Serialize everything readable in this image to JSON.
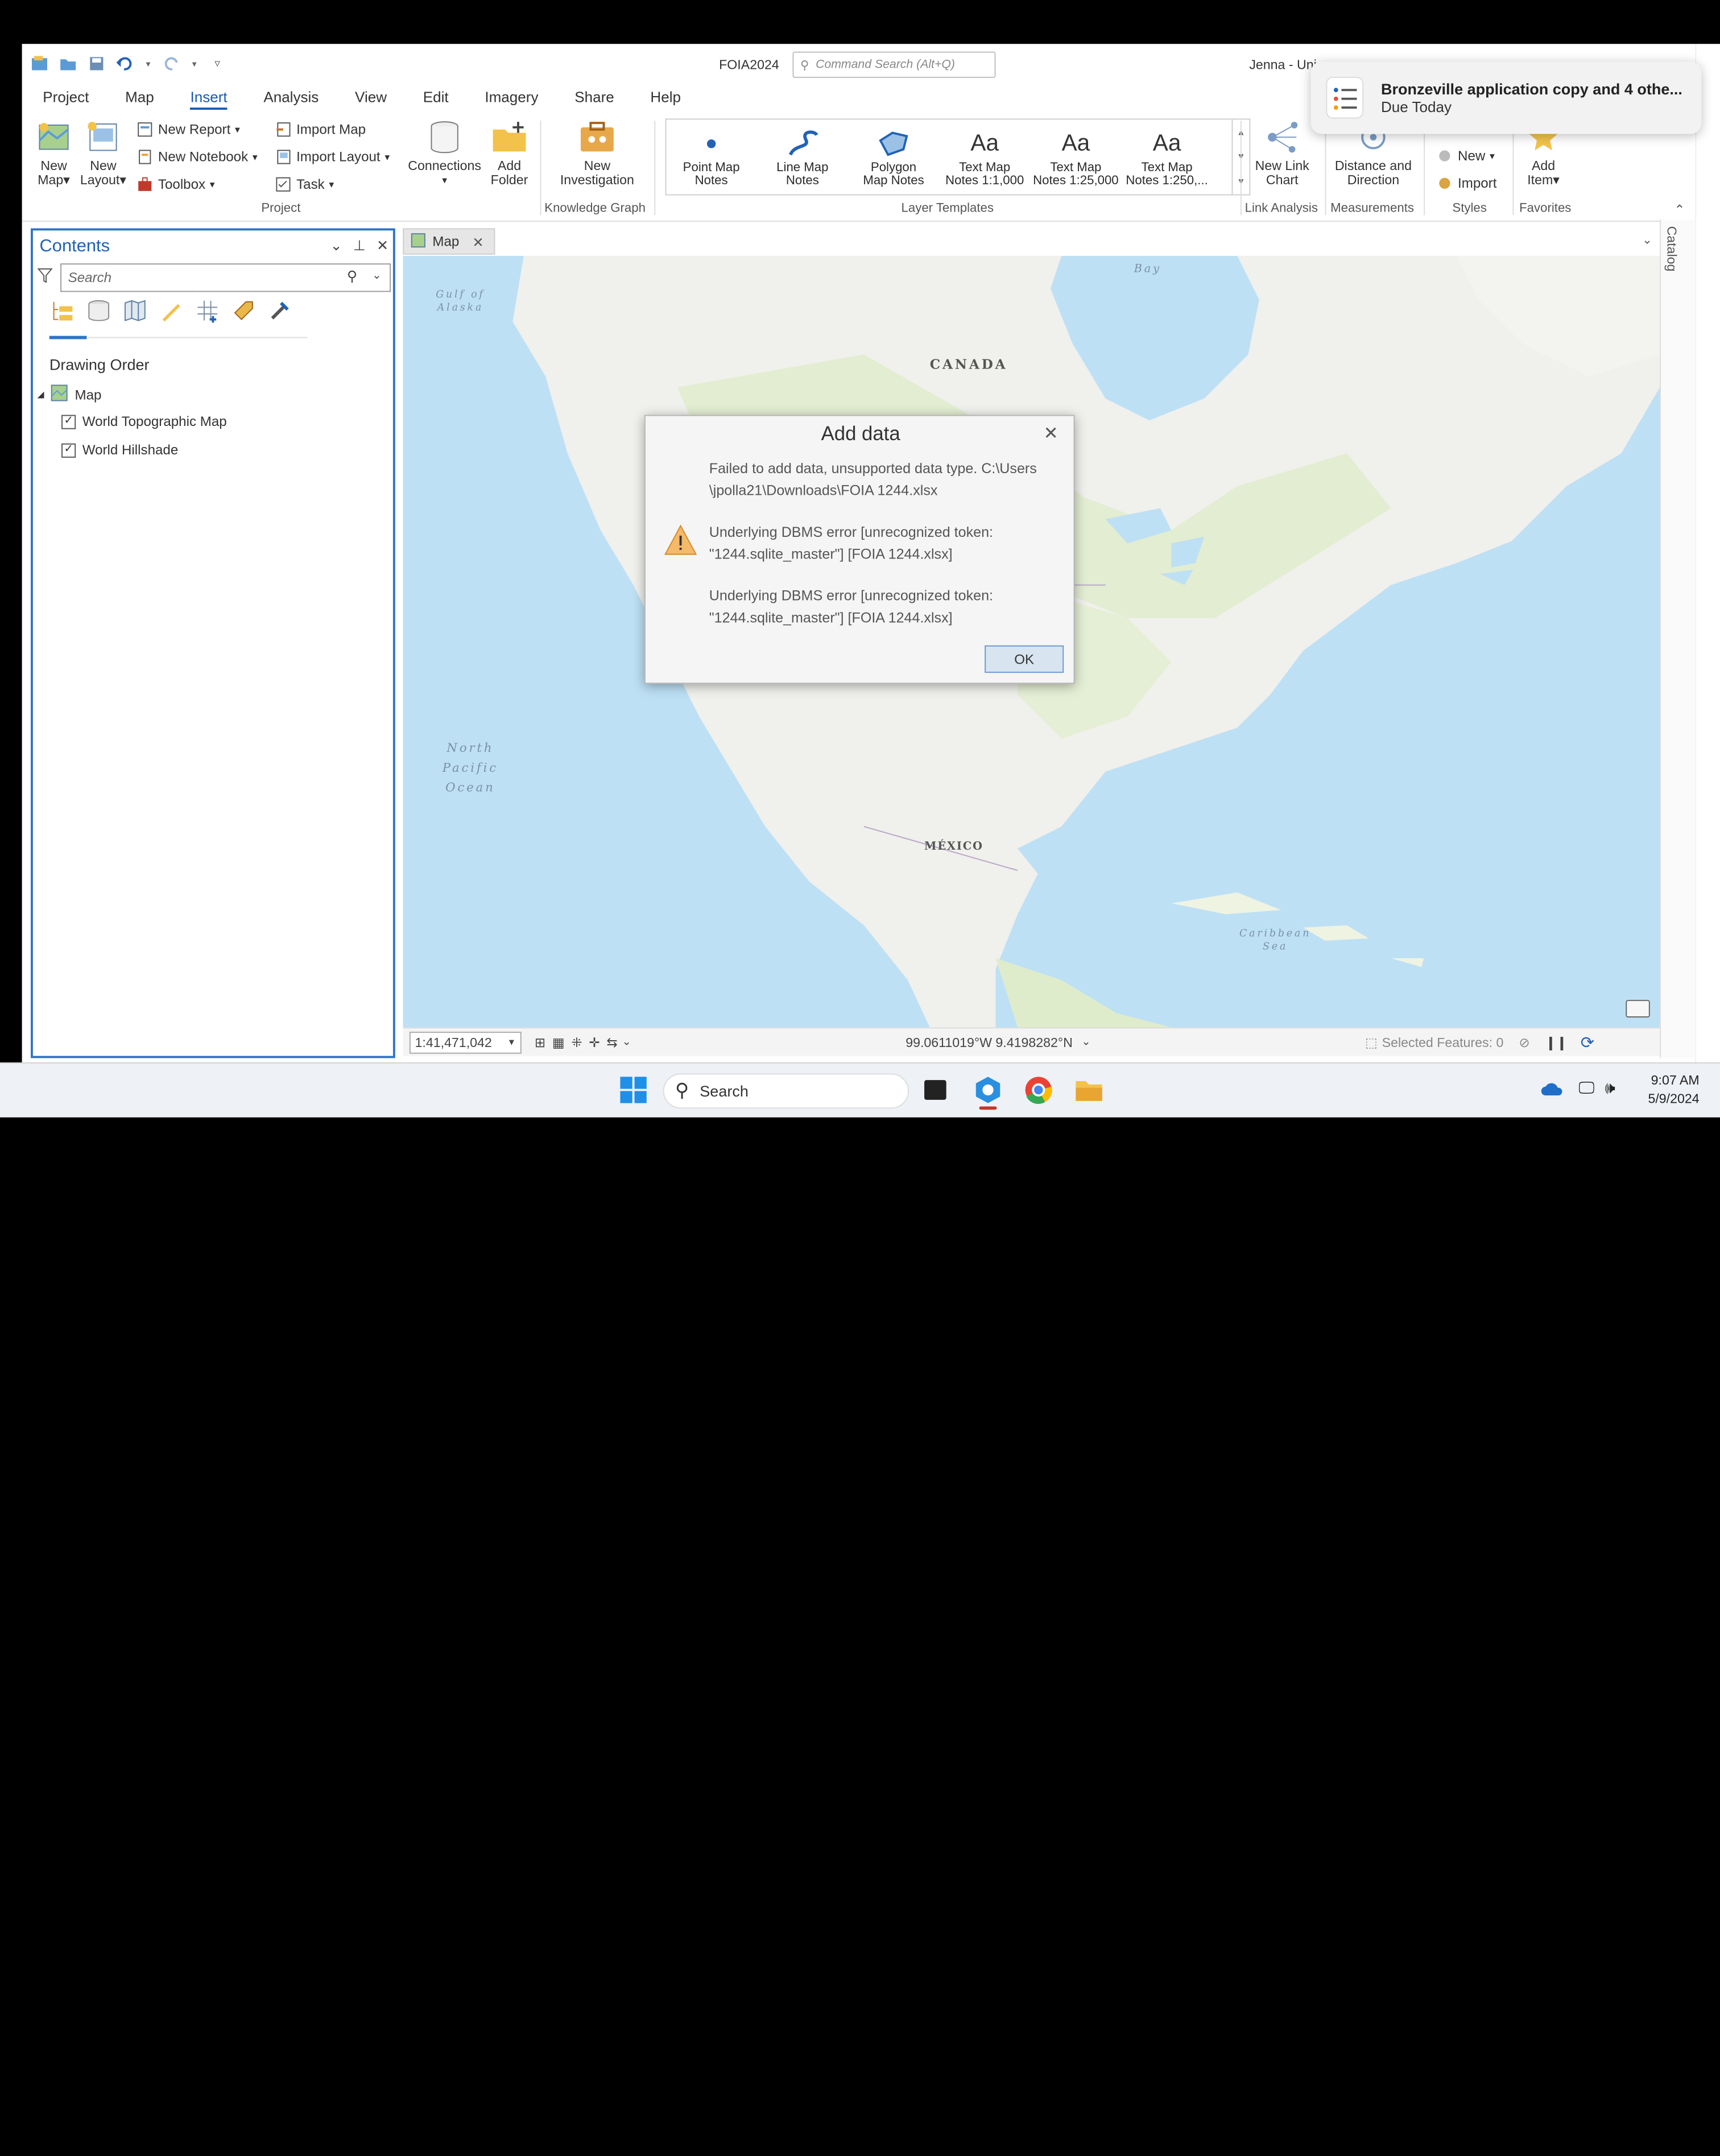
{
  "app": {
    "doc_title": "FOIA2024",
    "command_search_placeholder": "Command Search (Alt+Q)",
    "user_name": "Jenna - Uni"
  },
  "tabs": [
    {
      "label": "Project"
    },
    {
      "label": "Map"
    },
    {
      "label": "Insert"
    },
    {
      "label": "Analysis"
    },
    {
      "label": "View"
    },
    {
      "label": "Edit"
    },
    {
      "label": "Imagery"
    },
    {
      "label": "Share"
    },
    {
      "label": "Help"
    }
  ],
  "active_tab": "Insert",
  "ribbon": {
    "new_map": "New Map",
    "new_map_l1": "New",
    "new_map_l2": "Map",
    "new_layout_l1": "New",
    "new_layout_l2": "Layout",
    "new_report": "New Report",
    "new_notebook": "New Notebook",
    "toolbox": "Toolbox",
    "import_map": "Import Map",
    "import_layout": "Import Layout",
    "task": "Task",
    "connections": "Connections",
    "add_folder_l1": "Add",
    "add_folder_l2": "Folder",
    "group_project": "Project",
    "new_investigation_l1": "New",
    "new_investigation_l2": "Investigation",
    "group_knowledge_graph": "Knowledge Graph",
    "gallery": [
      {
        "l1": "Point Map",
        "l2": "Notes",
        "icon": "point-icon"
      },
      {
        "l1": "Line Map",
        "l2": "Notes",
        "icon": "line-icon"
      },
      {
        "l1": "Polygon",
        "l2": "Map Notes",
        "icon": "polygon-icon"
      },
      {
        "l1": "Text Map",
        "l2": "Notes 1:1,000",
        "icon": "text-aa-icon"
      },
      {
        "l1": "Text Map",
        "l2": "Notes 1:25,000",
        "icon": "text-aa-icon"
      },
      {
        "l1": "Text Map",
        "l2": "Notes 1:250,...",
        "icon": "text-aa-icon"
      }
    ],
    "gallery_glyph": "Aa",
    "group_layer_templates": "Layer Templates",
    "new_link_chart_l1": "New Link",
    "new_link_chart_l2": "Chart",
    "group_link_analysis": "Link Analysis",
    "distance_direction_l1": "Distance and",
    "distance_direction_l2": "Direction",
    "group_measurements": "Measurements",
    "styles_new": "New",
    "styles_import": "Import",
    "group_styles": "Styles",
    "add_item_l1": "Add",
    "add_item_l2": "Item",
    "group_favorites": "Favorites"
  },
  "contents": {
    "title": "Contents",
    "search_placeholder": "Search",
    "section": "Drawing Order",
    "map_node": "Map",
    "layers": [
      {
        "name": "World Topographic Map",
        "checked": true
      },
      {
        "name": "World Hillshade",
        "checked": true
      }
    ]
  },
  "map_tab": "Map",
  "map_labels": {
    "bay": "Bay",
    "gulf_l1": "Gulf of",
    "gulf_l2": "Alaska",
    "canada": "CANADA",
    "ocean_l1": "North",
    "ocean_l2": "Pacific",
    "ocean_l3": "Ocean",
    "mexico": "MÉXICO",
    "caribbean_l1": "Caribbean",
    "caribbean_l2": "Sea"
  },
  "statusbar": {
    "scale": "1:41,471,042",
    "coordinates": "99.0611019°W 9.4198282°N",
    "selected_features": "Selected Features: 0"
  },
  "catalog_label": "Catalog",
  "dialog": {
    "title": "Add data",
    "msg1_l1": "Failed to add data, unsupported data type. C:\\Users",
    "msg1_l2": "\\jpolla21\\Downloads\\FOIA 1244.xlsx",
    "msg2_l1": "Underlying DBMS error [unrecognized token:",
    "msg2_l2": "\"1244.sqlite_master\"] [FOIA 1244.xlsx]",
    "msg3_l1": "Underlying DBMS error [unrecognized token:",
    "msg3_l2": "\"1244.sqlite_master\"] [FOIA 1244.xlsx]",
    "ok": "OK"
  },
  "toast": {
    "title": "Bronzeville application copy and 4 othe...",
    "subtitle": "Due Today"
  },
  "taskbar": {
    "search": "Search",
    "time": "9:07 AM",
    "date": "5/9/2024"
  },
  "colors": {
    "accent": "#2162b5",
    "ocean": "#bde0f5",
    "land": "#f0f0ec"
  }
}
